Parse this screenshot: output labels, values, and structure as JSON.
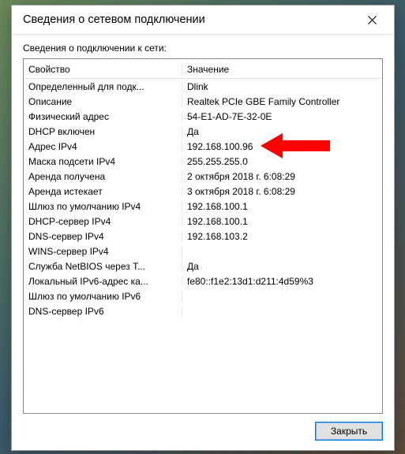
{
  "title": "Сведения о сетевом подключении",
  "section_label": "Сведения о подключении к сети:",
  "columns": {
    "property": "Свойство",
    "value": "Значение"
  },
  "rows": [
    {
      "prop": "Определенный для подк...",
      "val": "Dlink"
    },
    {
      "prop": "Описание",
      "val": "Realtek PCIe GBE Family Controller"
    },
    {
      "prop": "Физический адрес",
      "val": "54-E1-AD-7E-32-0E"
    },
    {
      "prop": "DHCP включен",
      "val": "Да"
    },
    {
      "prop": "Адрес IPv4",
      "val": "192.168.100.96"
    },
    {
      "prop": "Маска подсети IPv4",
      "val": "255.255.255.0"
    },
    {
      "prop": "Аренда получена",
      "val": "2 октября 2018 г. 6:08:29"
    },
    {
      "prop": "Аренда истекает",
      "val": "3 октября 2018 г. 6:08:29"
    },
    {
      "prop": "Шлюз по умолчанию IPv4",
      "val": "192.168.100.1"
    },
    {
      "prop": "DHCP-сервер IPv4",
      "val": "192.168.100.1"
    },
    {
      "prop": "DNS-сервер IPv4",
      "val": "192.168.103.2"
    },
    {
      "prop": "WINS-сервер IPv4",
      "val": ""
    },
    {
      "prop": "Служба NetBIOS через T...",
      "val": "Да"
    },
    {
      "prop": "Локальный IPv6-адрес ка...",
      "val": "fe80::f1e2:13d1:d211:4d59%3"
    },
    {
      "prop": "Шлюз по умолчанию IPv6",
      "val": ""
    },
    {
      "prop": "DNS-сервер IPv6",
      "val": ""
    }
  ],
  "close_button": "Закрыть",
  "arrow": {
    "row_index": 4,
    "color": "#ff0000"
  }
}
